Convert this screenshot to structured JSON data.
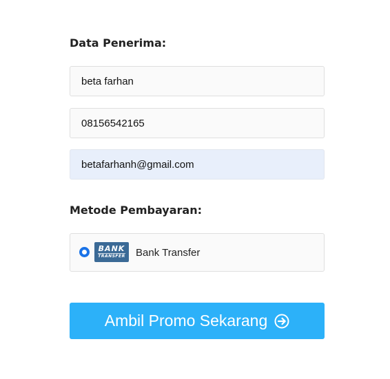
{
  "recipient": {
    "title": "Data Penerima:",
    "name_value": "beta farhan",
    "phone_value": "08156542165",
    "email_value": "betafarhanh@gmail.com"
  },
  "payment": {
    "title": "Metode Pembayaran:",
    "option_label": "Bank Transfer",
    "option_selected": true,
    "logo_line1": "BANK",
    "logo_line2": "TRANSFER"
  },
  "cta": {
    "label": "Ambil Promo Sekarang",
    "icon": "arrow-right-circle-icon"
  },
  "colors": {
    "cta_background": "#2cb1f9",
    "radio_accent": "#1a73e8",
    "autofill_background": "#e8effb",
    "bank_logo": "#3b6a96"
  }
}
